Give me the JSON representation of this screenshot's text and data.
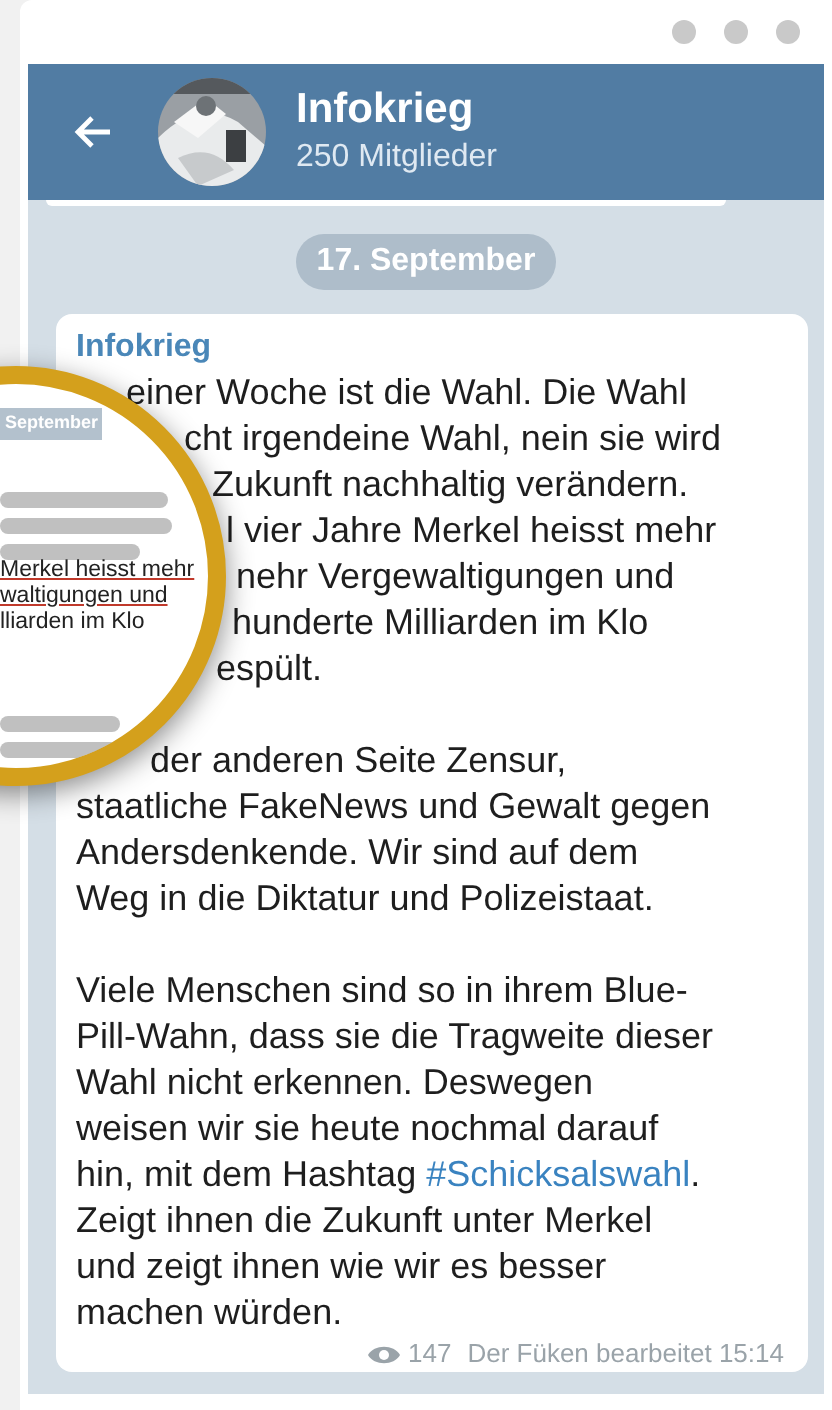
{
  "header": {
    "title": "Infokrieg",
    "subtitle": "250 Mitglieder"
  },
  "date_badge": "17. September",
  "message": {
    "sender": "Infokrieg",
    "paragraphs": [
      [
        {
          "text": "einer Woche ist die Wahl. Die Wahl"
        },
        {
          "text": "cht irgendeine Wahl, nein sie wird"
        },
        {
          "text": "Zukunft nachhaltig verändern."
        },
        {
          "text": "l vier Jahre Merkel heisst mehr"
        },
        {
          "text": "nehr Vergewaltigungen und"
        },
        {
          "text": "hunderte Milliarden im Klo"
        },
        {
          "text": "espült."
        }
      ],
      [
        {
          "text": "der anderen Seite Zensur,"
        },
        {
          "text": "staatliche FakeNews und Gewalt gegen"
        },
        {
          "text": "Andersdenkende. Wir sind auf dem"
        },
        {
          "text": "Weg in die Diktatur und Polizeistaat."
        }
      ],
      [
        {
          "text": "Viele Menschen sind so in ihrem Blue-"
        },
        {
          "text": "Pill-Wahn, dass sie die Tragweite dieser"
        },
        {
          "text": "Wahl nicht erkennen. Deswegen"
        },
        {
          "text": "weisen wir sie heute nochmal darauf"
        },
        {
          "text": "hin, mit dem Hashtag ",
          "hashtag": "#Schicksalswahl",
          "after": "."
        },
        {
          "text": "Zeigt ihnen die Zukunft unter Merkel"
        },
        {
          "text": "und zeigt ihnen wie wir es besser"
        },
        {
          "text": "machen würden."
        }
      ]
    ],
    "views": "147",
    "footer": "Der Füken bearbeitet 15:14"
  },
  "magnifier": {
    "date_badge": "September",
    "lines": [
      {
        "text": "Merkel heisst mehr",
        "underlined": true
      },
      {
        "text": "waltigungen und",
        "underlined": true
      },
      {
        "text": "lliarden im Klo",
        "underlined": false
      }
    ]
  }
}
